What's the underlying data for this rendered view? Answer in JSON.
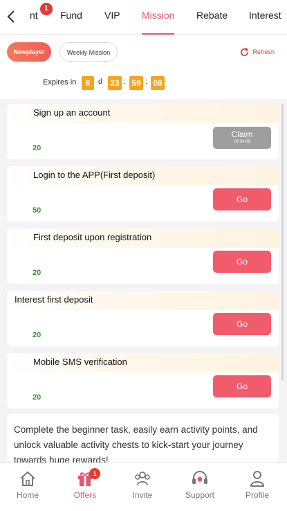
{
  "tabs": [
    {
      "label": "nt",
      "badge": "1"
    },
    {
      "label": "Fund"
    },
    {
      "label": "VIP"
    },
    {
      "label": "Mission",
      "active": true
    },
    {
      "label": "Rebate"
    },
    {
      "label": "Interest"
    }
  ],
  "filters": {
    "primary": "Newplayer",
    "secondary": "Weekly Mission",
    "refresh": "Refresh"
  },
  "expires": {
    "label": "Expires in",
    "days": "6",
    "day_unit": "d",
    "hours": "23",
    "minutes": "59",
    "seconds": "08",
    "separator": ":"
  },
  "tasks": [
    {
      "title": "Sign up an account",
      "points": "20",
      "button": "Claim",
      "countdown": "03:34:08"
    },
    {
      "title": "Login to the APP(First deposit)",
      "points": "50",
      "button": "Go"
    },
    {
      "title": "First deposit upon registration",
      "points": "20",
      "button": "Go"
    },
    {
      "title": "Interest first deposit",
      "points": "20",
      "button": "Go"
    },
    {
      "title": "Mobile SMS verification",
      "points": "20",
      "button": "Go"
    }
  ],
  "description": "Complete the beginner task, easily earn activity points, and unlock valuable activity chests to kick-start your journey towards huge rewards!",
  "nav": [
    {
      "label": "Home",
      "icon": "home-icon"
    },
    {
      "label": "Offers",
      "icon": "gift-icon",
      "badge": "1",
      "active": true
    },
    {
      "label": "Invite",
      "icon": "users-icon"
    },
    {
      "label": "Support",
      "icon": "headset-icon"
    },
    {
      "label": "Profile",
      "icon": "profile-icon"
    }
  ],
  "colors": {
    "accent": "#e9556a",
    "go_button": "#f15c6c",
    "timer": "#f6a41b",
    "points": "#2a9a2a",
    "claim_disabled": "#9e9e9e"
  }
}
